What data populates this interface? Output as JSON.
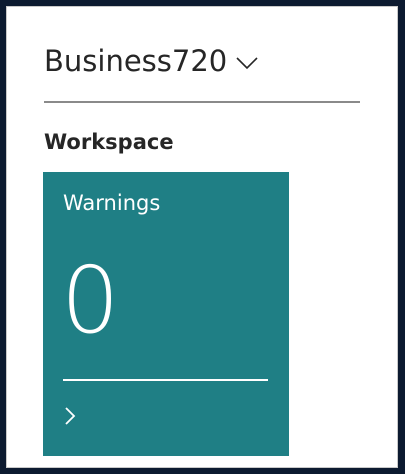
{
  "company": {
    "name": "Business720",
    "switch_icon": "chevron-down-icon"
  },
  "workspace": {
    "title": "Workspace",
    "tiles": [
      {
        "title": "Warnings",
        "value": "0",
        "drilldown_icon": "chevron-right-icon",
        "color": "#1f7f85"
      }
    ]
  },
  "colors": {
    "background": "#0c1a30",
    "panel": "#ffffff",
    "text": "#262626",
    "tile": "#1f7f85"
  }
}
